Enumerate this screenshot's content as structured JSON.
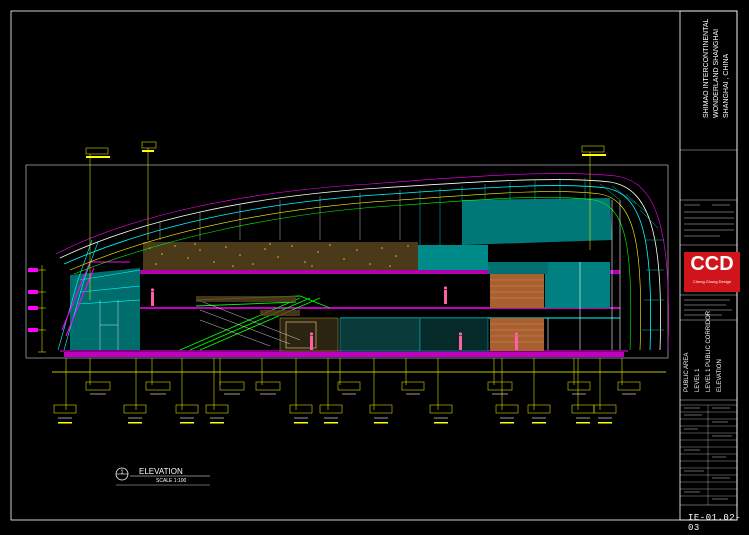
{
  "project": {
    "line1": "SHIMAO INTERCONTINENTAL",
    "line2": "WONDERLAND SHANGHAI",
    "line3": "SHANGHAI , CHINA"
  },
  "title_block": {
    "area": "PUBLIC AREA",
    "level": "LEVEL 1",
    "drawing_title": "LEVEL 1 PUBLIC CORRIDOR",
    "view": "ELEVATION"
  },
  "logo": {
    "name": "CCD",
    "tagline": "Cheng Chung Design"
  },
  "sheet_number": "IE-01.02-03",
  "elevation_label": {
    "number": "1",
    "title": "ELEVATION",
    "scale": "SCALE 1:100"
  },
  "colors": {
    "background": "#000000",
    "frame": "#ffffff",
    "dimension": "#ffff00",
    "structure": "#00ffff",
    "wall": "#00c0c0",
    "floor": "#ff00ff",
    "stair": "#00ff00",
    "timber": "#c8743c",
    "brand_red": "#d0141c"
  },
  "icons": {
    "logo": "ccd-logo-icon",
    "section_marker": "section-marker-icon"
  }
}
